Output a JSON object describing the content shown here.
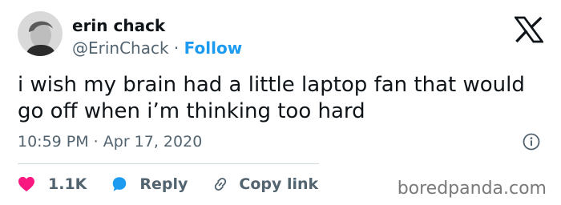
{
  "tweet": {
    "author": {
      "display_name": "erin chack",
      "handle": "@ErinChack",
      "separator": " · ",
      "follow_label": "Follow"
    },
    "text": "i wish my brain had a little laptop fan that would go off when i’m thinking too hard",
    "timestamp": "10:59 PM · Apr 17, 2020",
    "actions": {
      "likes": "1.1K",
      "reply_label": "Reply",
      "copy_link_label": "Copy link"
    }
  },
  "watermark": "boredpanda.com",
  "icons": {
    "logo": "x-logo-icon",
    "info": "info-icon",
    "like": "heart-icon",
    "reply": "speech-bubble-icon",
    "copy": "link-icon"
  },
  "colors": {
    "accent": "#1d9bf0",
    "like": "#f91880",
    "secondary_text": "#536471",
    "primary_text": "#0f1419"
  }
}
